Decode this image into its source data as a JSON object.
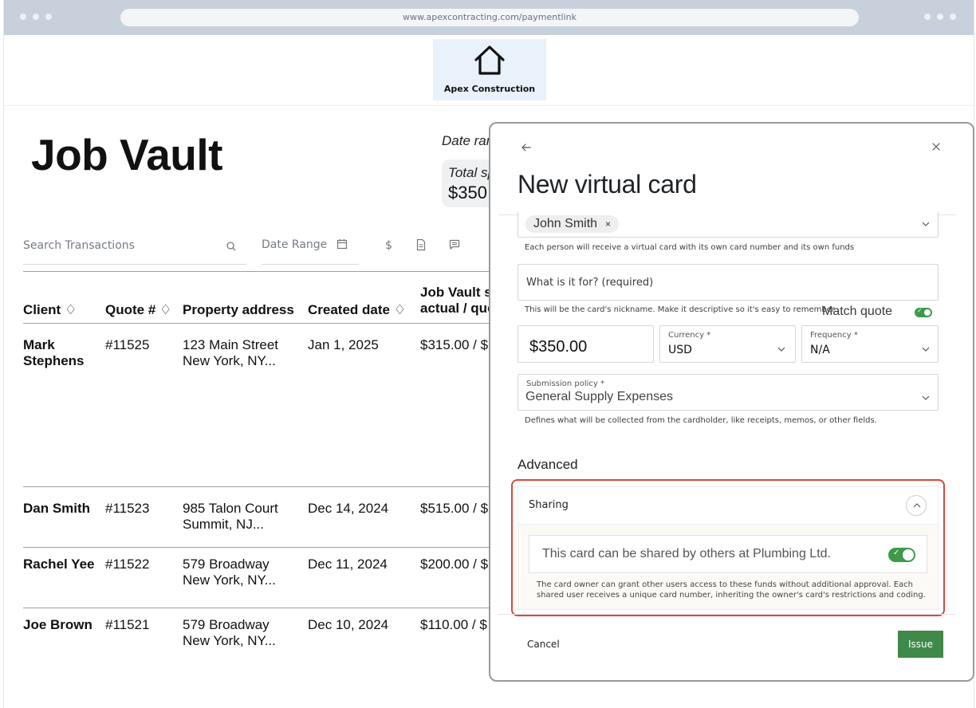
{
  "browser": {
    "url": "www.apexcontracting.com/paymentlink"
  },
  "brand": {
    "name": "Apex Construction"
  },
  "page": {
    "title": "Job Vault",
    "date_range_label": "Date ran",
    "total_spend_label": "Total sp",
    "total_spend_value": "$350"
  },
  "toolbar": {
    "search_placeholder": "Search Transactions",
    "date_range_placeholder": "Date Range"
  },
  "table": {
    "headers": {
      "client": "Client ♢",
      "quote": "Quote # ♢",
      "address": "Property address",
      "created": "Created date ♢",
      "vault_line1": "Job Vault s",
      "vault_line2": "actual / que"
    },
    "rows": [
      {
        "client_line1": "Mark",
        "client_line2": "Stephens",
        "quote": "#11525",
        "address_line1": "123 Main Street",
        "address_line2": "New York, NY...",
        "created": "Jan 1, 2025",
        "amount": "$315.00 / $"
      },
      {
        "client_line1": "Dan Smith",
        "client_line2": "",
        "quote": "#11523",
        "address_line1": "985 Talon Court",
        "address_line2": "Summit, NJ...",
        "created": "Dec 14, 2024",
        "amount": "$515.00 / $"
      },
      {
        "client_line1": "Rachel Yee",
        "client_line2": "",
        "quote": "#11522",
        "address_line1": "579 Broadway",
        "address_line2": "New York, NY...",
        "created": "Dec 11, 2024",
        "amount": "$200.00 / $"
      },
      {
        "client_line1": "Joe Brown",
        "client_line2": "",
        "quote": "#11521",
        "address_line1": "579 Broadway",
        "address_line2": "New York, NY...",
        "created": "Dec 10, 2024",
        "amount": "$110.00 / $"
      }
    ]
  },
  "modal": {
    "title": "New virtual card",
    "person_chip": "John Smith",
    "chip_remove": "×",
    "person_help": "Each person will receive a virtual card with its own card number and its own funds",
    "purpose_placeholder": "What is it for? (required)",
    "purpose_help": "This will be the card's nickname. Make it descriptive so it's easy to remember.",
    "match_quote_label": "Match quote",
    "match_quote_on": true,
    "amount_value": "$350.00",
    "currency_label": "Currency *",
    "currency_value": "USD",
    "frequency_label": "Frequency *",
    "frequency_value": "N/A",
    "policy_label": "Submission policy *",
    "policy_value": "General Supply Expenses",
    "policy_help": "Defines what will be collected from the cardholder, like receipts, memos, or other fields.",
    "advanced_label": "Advanced",
    "sharing_title": "Sharing",
    "sharing_toggle_text": "This card can be shared by others at Plumbing Ltd.",
    "sharing_on": true,
    "sharing_help": "The card owner can grant other users access to these funds without additional approval. Each shared user receives a unique card number, inheriting the owner's card's restrictions and coding.",
    "cancel_label": "Cancel",
    "issue_label": "Issue"
  },
  "colors": {
    "accent_green": "#3f8a48",
    "highlight_red": "#d9483b",
    "browser_chrome": "#c8d0dc"
  }
}
